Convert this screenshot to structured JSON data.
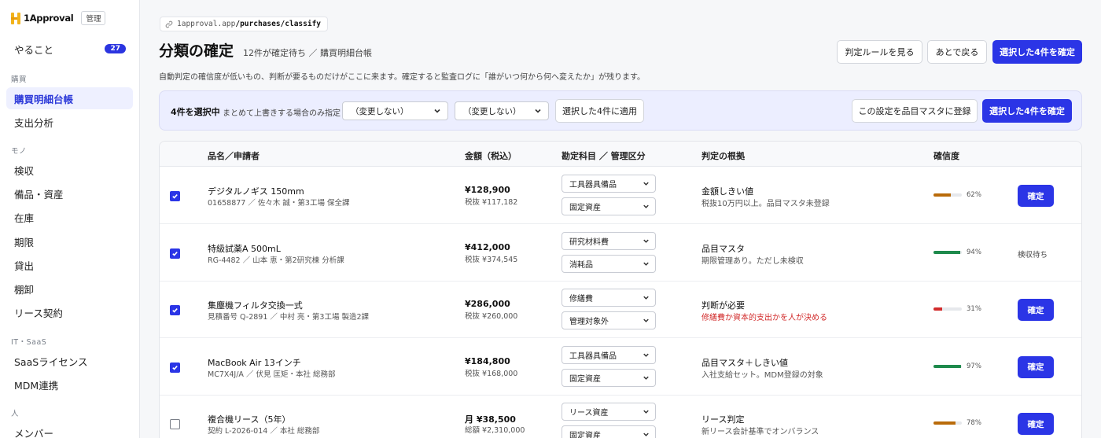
{
  "app": {
    "name": "1Approval",
    "admin_badge": "管理",
    "brand_colors": {
      "accent": "#2b35e6",
      "logo": "#f2b31b"
    }
  },
  "sidebar": {
    "todo": {
      "label": "やること",
      "count": "27"
    },
    "sections": [
      {
        "label": "購買",
        "items": [
          "購買明細台帳",
          "支出分析"
        ]
      },
      {
        "label": "モノ",
        "items": [
          "検収",
          "備品・資産",
          "在庫",
          "期限",
          "貸出",
          "棚卸",
          "リース契約"
        ]
      },
      {
        "label": "IT・SaaS",
        "items": [
          "SaaSライセンス",
          "MDM連携"
        ]
      },
      {
        "label": "人",
        "items": [
          "メンバー"
        ]
      }
    ],
    "active_item": "購買明細台帳"
  },
  "header": {
    "url_prefix": "1approval.app",
    "url_path": "/purchases/classify",
    "title": "分類の確定",
    "subtitle": "12件が確定待ち ／ 購買明細台帳",
    "description": "自動判定の確信度が低いもの、判断が要るものだけがここに来ます。確定すると監査ログに「誰がいつ何から何へ変えたか」が残ります。",
    "buttons": {
      "rules": "判定ルールを見る",
      "later": "あとで戻る",
      "confirm": "選択した4件を確定"
    }
  },
  "bulk": {
    "selected": "4件を選択中",
    "note": "まとめて上書きする場合のみ指定",
    "select1": "（変更しない）",
    "select2": "（変更しない）",
    "apply": "選択した4件に適用",
    "register": "この設定を品目マスタに登録",
    "confirm": "選択した4件を確定"
  },
  "table": {
    "headers": {
      "name": "品名／申請者",
      "amount": "金額（税込）",
      "account": "勘定科目 ／ 管理区分",
      "basis": "判定の根拠",
      "confidence": "確信度"
    },
    "rows": [
      {
        "checked": true,
        "name": "デジタルノギス 150mm",
        "meta": "01658877 ／ 佐々木 誠・第3工場 保全課",
        "amount": "¥128,900",
        "amount_sub": "税抜 ¥117,182",
        "account": "工具器具備品",
        "category": "固定資産",
        "basis": "金額しきい値",
        "basis_sub": "税抜10万円以上。品目マスタ未登録",
        "warn": false,
        "confidence": 0.62,
        "conf_label": "62%",
        "bar_color": "#b96b0a",
        "action": "確定",
        "action_type": "button"
      },
      {
        "checked": true,
        "name": "特級試薬A 500mL",
        "meta": "RG-4482 ／ 山本 恵・第2研究棟 分析課",
        "amount": "¥412,000",
        "amount_sub": "税抜 ¥374,545",
        "account": "研究材料費",
        "category": "消耗品",
        "basis": "品目マスタ",
        "basis_sub": "期限管理あり。ただし未検収",
        "warn": false,
        "confidence": 0.94,
        "conf_label": "94%",
        "bar_color": "#1e8a4c",
        "action": "検収待ち",
        "action_type": "status"
      },
      {
        "checked": true,
        "name": "集塵機フィルタ交換一式",
        "meta": "見積番号 Q-2891 ／ 中村 亮・第3工場 製造2課",
        "amount": "¥286,000",
        "amount_sub": "税抜 ¥260,000",
        "account": "修繕費",
        "category": "管理対象外",
        "basis": "判断が必要",
        "basis_sub": "修繕費か資本的支出かを人が決める",
        "warn": true,
        "confidence": 0.31,
        "conf_label": "31%",
        "bar_color": "#d22c2c",
        "action": "確定",
        "action_type": "button"
      },
      {
        "checked": true,
        "name": "MacBook Air 13インチ",
        "meta": "MC7X4J/A ／ 伏見 匡矩・本社 総務部",
        "amount": "¥184,800",
        "amount_sub": "税抜 ¥168,000",
        "account": "工具器具備品",
        "category": "固定資産",
        "basis": "品目マスタ＋しきい値",
        "basis_sub": "入社支給セット。MDM登録の対象",
        "warn": false,
        "confidence": 0.97,
        "conf_label": "97%",
        "bar_color": "#1e8a4c",
        "action": "確定",
        "action_type": "button"
      },
      {
        "checked": false,
        "name": "複合機リース（5年）",
        "meta": "契約 L-2026-014 ／ 本社 総務部",
        "amount": "月 ¥38,500",
        "amount_sub": "総額 ¥2,310,000",
        "account": "リース資産",
        "category": "固定資産",
        "basis": "リース判定",
        "basis_sub": "新リース会計基準でオンバランス",
        "warn": false,
        "confidence": 0.78,
        "conf_label": "78%",
        "bar_color": "#b96b0a",
        "action": "確定",
        "action_type": "button"
      }
    ]
  }
}
